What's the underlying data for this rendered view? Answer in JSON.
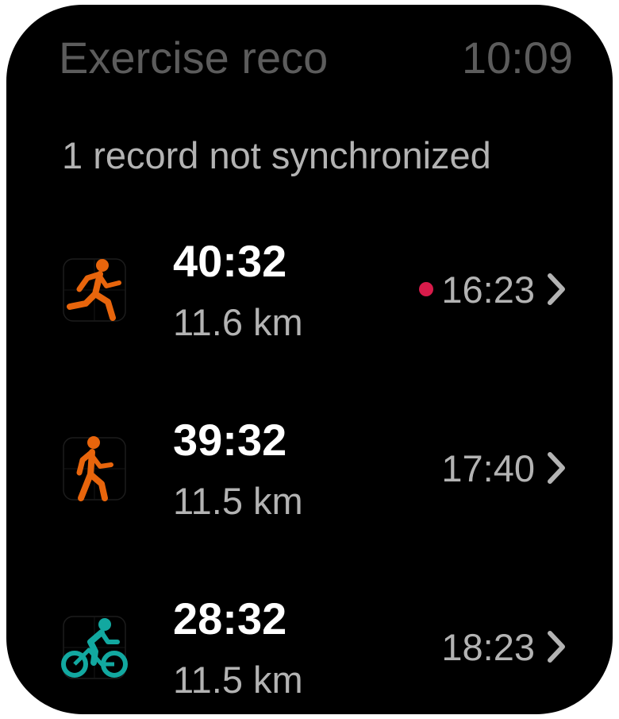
{
  "header": {
    "title": "Exercise reco",
    "time": "10:09"
  },
  "sync_notice": "1 record not synchronized",
  "records": [
    {
      "activity_icon": "running-icon",
      "icon_color": "#e8650c",
      "duration": "40:32",
      "distance": "11.6 km",
      "time": "16:23",
      "unsynced": true
    },
    {
      "activity_icon": "walking-icon",
      "icon_color": "#e8650c",
      "duration": "39:32",
      "distance": "11.5 km",
      "time": "17:40",
      "unsynced": false
    },
    {
      "activity_icon": "cycling-icon",
      "icon_color": "#12a8a0",
      "duration": "28:32",
      "distance": "11.5 km",
      "time": "18:23",
      "unsynced": false
    }
  ],
  "colors": {
    "background": "#000000",
    "unsynced_dot": "#d81b4a",
    "primary_text": "#ffffff",
    "secondary_text": "#b3b3b3",
    "header_text": "#5c5c5c"
  }
}
